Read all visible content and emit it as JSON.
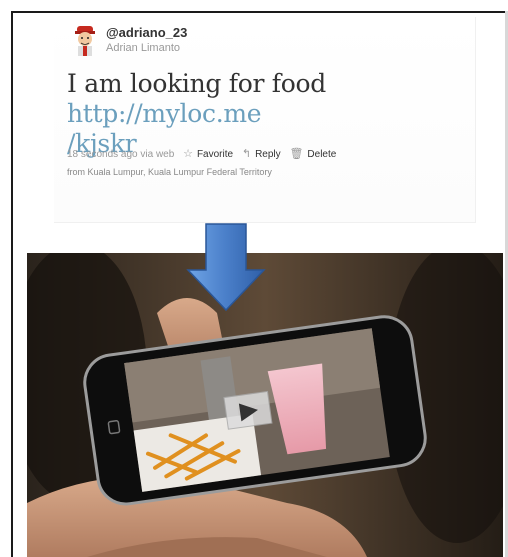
{
  "tweet": {
    "screen_name": "@adriano_23",
    "full_name": "Adrian Limanto",
    "text": "I am looking for food ",
    "link": "http://myloc.me",
    "link_cont": "/kjskr",
    "timestamp": "18 seconds ago via web",
    "actions": {
      "favorite": "Favorite",
      "reply": "Reply",
      "delete": "Delete"
    },
    "location": "from Kuala Lumpur, Kuala Lumpur Federal Territory"
  },
  "icons": {
    "favorite": "star-outline-icon",
    "reply": "reply-arrow-icon",
    "delete": "trash-icon",
    "arrow": "down-arrow-icon",
    "play": "play-icon"
  },
  "colors": {
    "link": "#6b9fbd",
    "arrow": "#4a7fc9"
  }
}
